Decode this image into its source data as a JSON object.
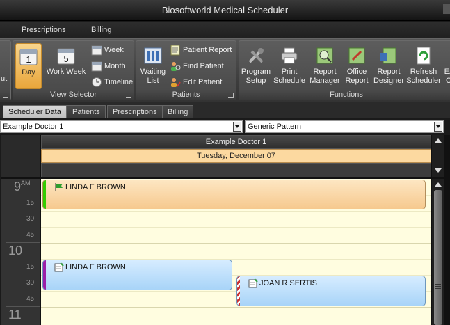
{
  "app": {
    "title": "Biosoftworld Medical Scheduler"
  },
  "menu": {
    "items": [
      "Prescriptions",
      "Billing"
    ]
  },
  "ribbon": {
    "cutoff_left_label": "ut",
    "view_selector": {
      "label": "View Selector",
      "day": "Day",
      "work_week": "Work Week",
      "week": "Week",
      "month": "Month",
      "timeline": "Timeline"
    },
    "patients": {
      "label": "Patients",
      "waiting_list_line1": "Waiting",
      "waiting_list_line2": "List",
      "patient_report": "Patient Report",
      "find_patient": "Find Patient",
      "edit_patient": "Edit Patient"
    },
    "functions": {
      "label": "Functions",
      "program_setup": [
        "Program",
        "Setup"
      ],
      "print_schedule": [
        "Print",
        "Schedule"
      ],
      "report_manager": [
        "Report",
        "Manager"
      ],
      "office_report": [
        "Office",
        "Report"
      ],
      "report_designer": [
        "Report",
        "Designer"
      ],
      "refresh_scheduler": [
        "Refresh",
        "Scheduler"
      ],
      "cutoff": [
        "Ex",
        "C"
      ]
    }
  },
  "tabs": [
    "Scheduler Data",
    "Patients",
    "Prescriptions",
    "Billing"
  ],
  "filters": {
    "doctor": "Example Doctor 1",
    "pattern": "Generic Pattern"
  },
  "scheduler": {
    "resource": "Example Doctor 1",
    "date": "Tuesday, December 07",
    "hours": [
      {
        "hour": "9",
        "ampm": "AM",
        "minutes": [
          "15",
          "30",
          "45"
        ]
      },
      {
        "hour": "10",
        "ampm": "",
        "minutes": [
          "15",
          "30",
          "45"
        ]
      },
      {
        "hour": "11",
        "ampm": "",
        "minutes": []
      }
    ],
    "appointments": [
      {
        "patient": "LINDA F BROWN",
        "status_color": "#33cc00",
        "color": "orange",
        "icon": "flag-icon"
      },
      {
        "patient": "LINDA F BROWN",
        "status_color": "#9b1fa8",
        "color": "blue",
        "icon": "note-icon"
      },
      {
        "patient": "JOAN R SERTIS",
        "status_color": "#cc3333",
        "color": "blue",
        "icon": "note-icon"
      }
    ]
  },
  "colors": {
    "accent": "#e9a63b",
    "date_header": "#fcd9a0",
    "grid_bg": "#fffde0"
  }
}
